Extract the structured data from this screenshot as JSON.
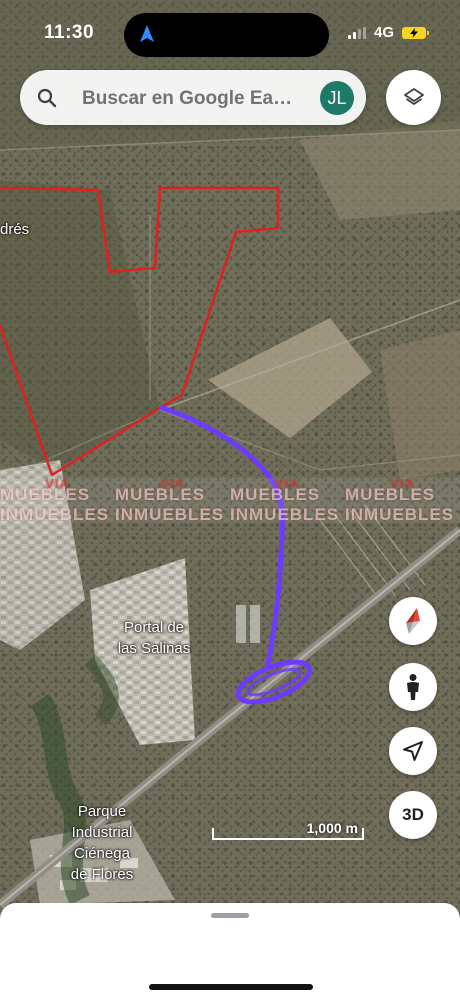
{
  "status_bar": {
    "time": "11:30",
    "network": "4G"
  },
  "search": {
    "placeholder": "Buscar en Google Ea…",
    "avatar_initials": "JL"
  },
  "map": {
    "type": "satellite",
    "labels": {
      "partial_place": "drés",
      "portal_line1": "Portal de",
      "portal_line2": "las Salinas",
      "parque_line1": "Parque",
      "parque_line2": "Industrial",
      "parque_line3": "Ciénega",
      "parque_line4": "de Flores"
    },
    "scale_label": "1,000 m",
    "watermark": [
      "MUEBLES INMUEBLES",
      "MUEBLES INMUEBLES",
      "MUEBLES INMUEBLES",
      "MUEBLES INMUEBLES"
    ],
    "colors": {
      "boundary": "#e02020",
      "route": "#6d3bff",
      "highway": "#9a9a94"
    }
  },
  "controls": {
    "three_d_label": "3D"
  },
  "icons": [
    "navigation-arrow-icon",
    "signal-icon",
    "battery-charging-icon",
    "search-icon",
    "layers-icon",
    "compass-icon",
    "street-view-person-icon",
    "my-location-icon"
  ]
}
